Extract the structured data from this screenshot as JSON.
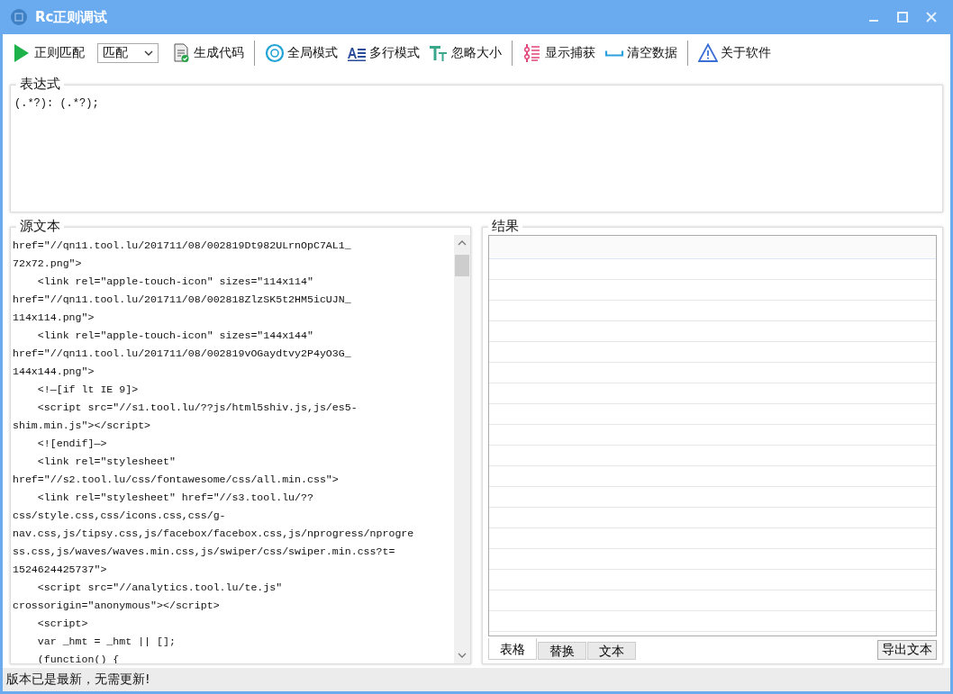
{
  "window": {
    "title": "Rc正则调试"
  },
  "toolbar": {
    "items": [
      {
        "kind": "run",
        "label": "正则匹配"
      },
      {
        "kind": "select",
        "value": "匹配"
      },
      {
        "kind": "code",
        "label": "生成代码"
      },
      {
        "kind": "separator"
      },
      {
        "kind": "global",
        "label": "全局模式"
      },
      {
        "kind": "multiline",
        "label": "多行模式"
      },
      {
        "kind": "ignorecase",
        "label": "忽略大小"
      },
      {
        "kind": "separator"
      },
      {
        "kind": "captures",
        "label": "显示捕获"
      },
      {
        "kind": "clear",
        "label": "清空数据"
      },
      {
        "kind": "separator"
      },
      {
        "kind": "about",
        "label": "关于软件"
      }
    ]
  },
  "expression": {
    "label": "表达式",
    "value": "(.*?): (.*?);"
  },
  "source": {
    "label": "源文本",
    "lines": [
      "href=\"//qn11.tool.lu/201711/08/002819Dt982ULrnOpC7AL1_",
      "72x72.png\">",
      "    <link rel=\"apple-touch-icon\" sizes=\"114x114\"",
      "href=\"//qn11.tool.lu/201711/08/002818ZlzSK5t2HM5icUJN_",
      "114x114.png\">",
      "    <link rel=\"apple-touch-icon\" sizes=\"144x144\"",
      "href=\"//qn11.tool.lu/201711/08/002819vOGaydtvy2P4yO3G_",
      "144x144.png\">",
      "    <!—[if lt IE 9]>",
      "    <script src=\"//s1.tool.lu/??js/html5shiv.js,js/es5-",
      "shim.min.js\"></script>",
      "    <![endif]—>",
      "    <link rel=\"stylesheet\"",
      "href=\"//s2.tool.lu/css/fontawesome/css/all.min.css\">",
      "    <link rel=\"stylesheet\" href=\"//s3.tool.lu/??",
      "css/style.css,css/icons.css,css/g-",
      "nav.css,js/tipsy.css,js/facebox/facebox.css,js/nprogress/nprogre",
      "ss.css,js/waves/waves.min.css,js/swiper/css/swiper.min.css?t=",
      "1524624425737\">",
      "    <script src=\"//analytics.tool.lu/te.js\"",
      "crossorigin=\"anonymous\"></script>",
      "    <script>",
      "    var _hmt = _hmt || [];",
      "    (function() {"
    ]
  },
  "result": {
    "label": "结果",
    "tabs": [
      {
        "label": "表格",
        "selected": true
      },
      {
        "label": "替换",
        "selected": false
      },
      {
        "label": "文本",
        "selected": false
      }
    ],
    "export_button": "导出文本"
  },
  "status_bar": "版本已是最新，无需更新!"
}
